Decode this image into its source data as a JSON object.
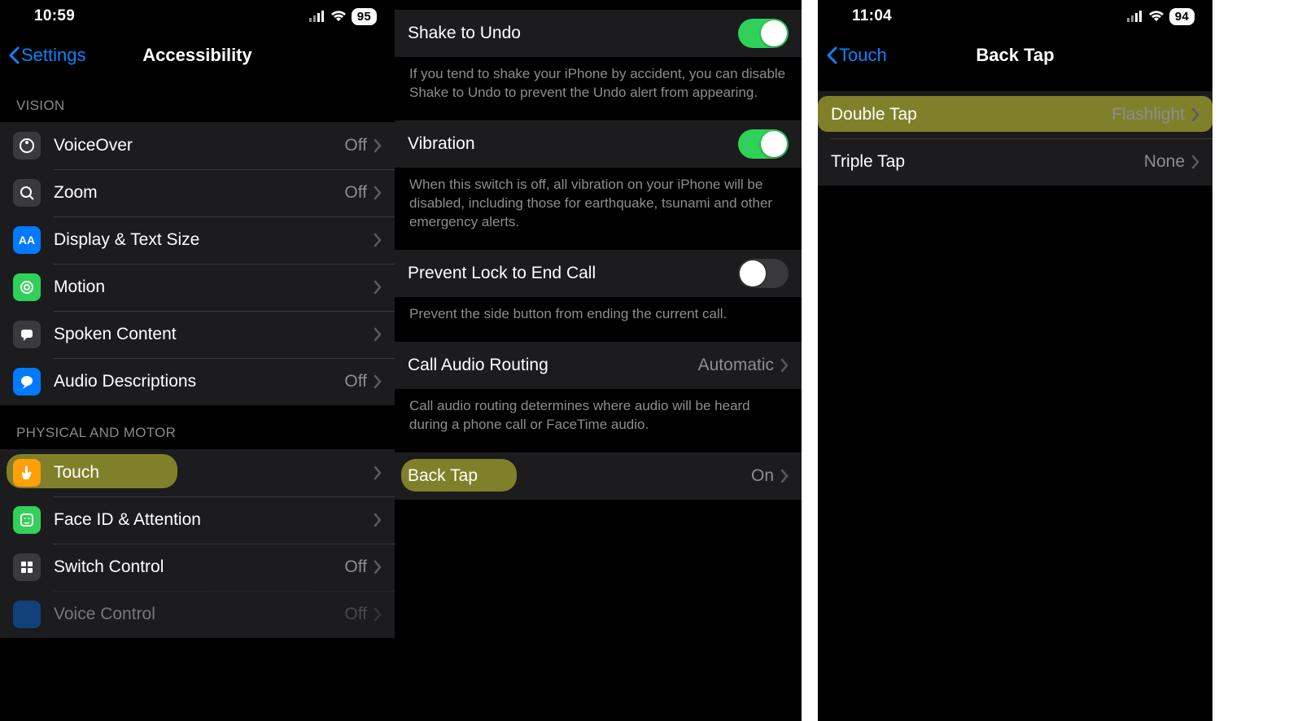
{
  "left": {
    "time": "10:59",
    "battery": "95",
    "back_label": "Settings",
    "title": "Accessibility",
    "sections": {
      "vision": {
        "header": "VISION",
        "items": [
          {
            "label": "VoiceOver",
            "value": "Off"
          },
          {
            "label": "Zoom",
            "value": "Off"
          },
          {
            "label": "Display & Text Size",
            "value": ""
          },
          {
            "label": "Motion",
            "value": ""
          },
          {
            "label": "Spoken Content",
            "value": ""
          },
          {
            "label": "Audio Descriptions",
            "value": "Off"
          }
        ]
      },
      "physical": {
        "header": "PHYSICAL AND MOTOR",
        "items": [
          {
            "label": "Touch",
            "value": ""
          },
          {
            "label": "Face ID & Attention",
            "value": ""
          },
          {
            "label": "Switch Control",
            "value": "Off"
          },
          {
            "label": "Voice Control",
            "value": "Off"
          }
        ]
      }
    }
  },
  "mid": {
    "items": {
      "shake": {
        "label": "Shake to Undo",
        "on": true,
        "footer": "If you tend to shake your iPhone by accident, you can disable Shake to Undo to prevent the Undo alert from appearing."
      },
      "vib": {
        "label": "Vibration",
        "on": true,
        "footer": "When this switch is off, all vibration on your iPhone will be disabled, including those for earthquake, tsunami and other emergency alerts."
      },
      "prevent": {
        "label": "Prevent Lock to End Call",
        "on": false,
        "footer": "Prevent the side button from ending the current call."
      },
      "routing": {
        "label": "Call Audio Routing",
        "value": "Automatic",
        "footer": "Call audio routing determines where audio will be heard during a phone call or FaceTime audio."
      },
      "backtap": {
        "label": "Back Tap",
        "value": "On"
      }
    }
  },
  "right": {
    "time": "11:04",
    "battery": "94",
    "back_label": "Touch",
    "title": "Back Tap",
    "items": [
      {
        "label": "Double Tap",
        "value": "Flashlight"
      },
      {
        "label": "Triple Tap",
        "value": "None"
      }
    ]
  }
}
